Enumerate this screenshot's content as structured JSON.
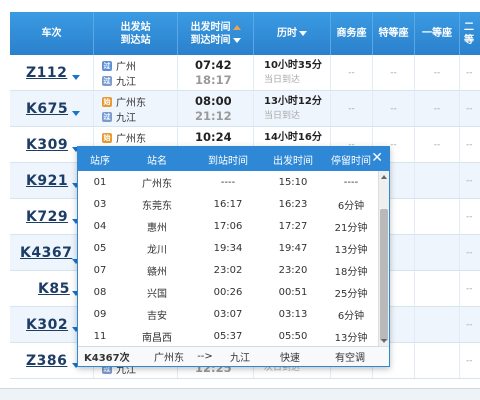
{
  "header": {
    "train": "车次",
    "station_top": "出发站",
    "station_bottom": "到达站",
    "time_top": "出发时间",
    "time_bottom": "到达时间",
    "duration": "历时",
    "business": "商务座",
    "special": "特等座",
    "first": "一等座",
    "second": "二等"
  },
  "trains": [
    {
      "no": "Z112",
      "from": "广州",
      "to": "九江",
      "from_badge": "过",
      "to_badge": "过",
      "dep": "07:42",
      "arr": "18:17",
      "duration": "10小时35分",
      "day": "当日到达",
      "seat": "--"
    },
    {
      "no": "K675",
      "from": "广州东",
      "to": "九江",
      "from_badge": "始",
      "to_badge": "过",
      "dep": "08:00",
      "arr": "21:12",
      "duration": "13小时12分",
      "day": "当日到达",
      "seat": "--"
    },
    {
      "no": "K309",
      "from": "广州东",
      "to": "",
      "from_badge": "始",
      "to_badge": "",
      "dep": "10:24",
      "arr": "",
      "duration": "14小时16分",
      "day": "",
      "seat": "--"
    },
    {
      "no": "K921",
      "seat": "--"
    },
    {
      "no": "K729",
      "seat": "--"
    },
    {
      "no": "K4367",
      "seat": "--"
    },
    {
      "no": "K85",
      "seat": "--"
    },
    {
      "no": "K302",
      "seat": "--"
    },
    {
      "no": "Z386",
      "from": "",
      "to": "九江",
      "to_badge": "过",
      "dep": "",
      "arr": "12:25",
      "duration": "",
      "day": "次日到达",
      "seat": "--"
    }
  ],
  "popup": {
    "headers": [
      "站序",
      "站名",
      "到站时间",
      "出发时间",
      "停留时间"
    ],
    "close": "✕",
    "stops": [
      [
        "01",
        "广州东",
        "----",
        "15:10",
        "----"
      ],
      [
        "03",
        "东莞东",
        "16:17",
        "16:23",
        "6分钟"
      ],
      [
        "04",
        "惠州",
        "17:06",
        "17:27",
        "21分钟"
      ],
      [
        "05",
        "龙川",
        "19:34",
        "19:47",
        "13分钟"
      ],
      [
        "07",
        "赣州",
        "23:02",
        "23:20",
        "18分钟"
      ],
      [
        "08",
        "兴国",
        "00:26",
        "00:51",
        "25分钟"
      ],
      [
        "09",
        "吉安",
        "03:07",
        "03:13",
        "6分钟"
      ],
      [
        "11",
        "南昌西",
        "05:37",
        "05:50",
        "13分钟"
      ]
    ],
    "footer": {
      "train": "K4367次",
      "from": "广州东",
      "arrow": "-->",
      "to": "九江",
      "type": "快速",
      "ac": "有空调"
    }
  }
}
